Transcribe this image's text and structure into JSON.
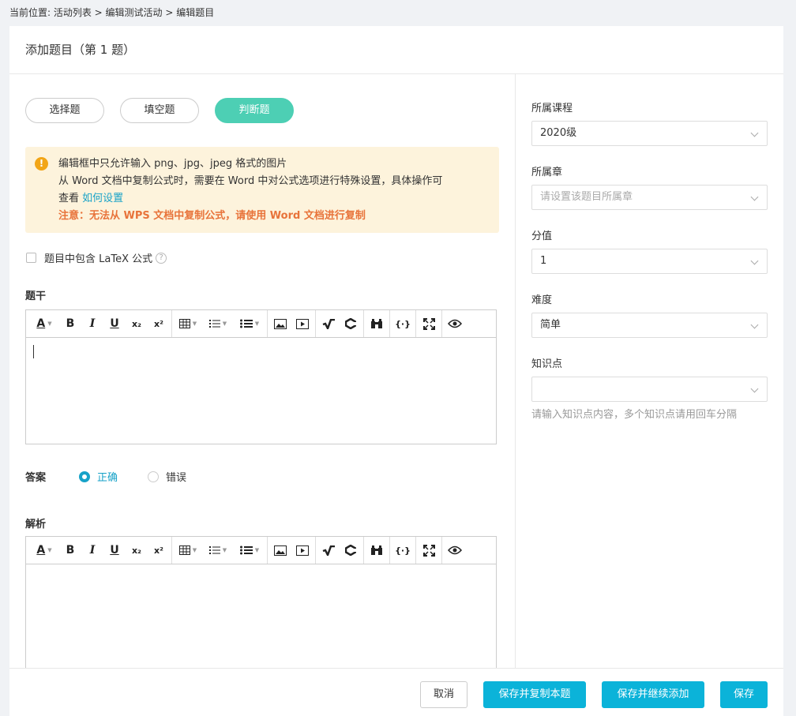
{
  "breadcrumb": {
    "text": "当前位置: 活动列表 > 编辑测试活动 > 编辑题目"
  },
  "header": {
    "title": "添加题目（第 1 题）"
  },
  "question_types": [
    {
      "label": "选择题",
      "active": false
    },
    {
      "label": "填空题",
      "active": false
    },
    {
      "label": "判断题",
      "active": true
    }
  ],
  "notice": {
    "line1": "编辑框中只允许输入 png、jpg、jpeg 格式的图片",
    "line2": "从 Word 文档中复制公式时，需要在 Word 中对公式选项进行特殊设置，具体操作可",
    "line3_prefix": "查看",
    "link": "如何设置",
    "warning": "注意：无法从 WPS 文档中复制公式，请使用 Word 文档进行复制"
  },
  "latex_option": {
    "label": "题目中包含 LaTeX 公式",
    "help": "?"
  },
  "stem": {
    "label": "题干"
  },
  "answer": {
    "label": "答案",
    "options": [
      {
        "label": "正确",
        "selected": true
      },
      {
        "label": "错误",
        "selected": false
      }
    ]
  },
  "analysis": {
    "label": "解析"
  },
  "toolbar_glyphs": {
    "font_color": "A",
    "bold": "B",
    "italic": "I",
    "underline": "U",
    "subscript": "x₂",
    "superscript": "x²",
    "formula": "{·}"
  },
  "sidebar": {
    "course": {
      "label": "所属课程",
      "value": "2020级"
    },
    "chapter": {
      "label": "所属章",
      "placeholder": "请设置该题目所属章"
    },
    "score": {
      "label": "分值",
      "value": "1"
    },
    "difficulty": {
      "label": "难度",
      "value": "简单"
    },
    "knowledge": {
      "label": "知识点",
      "value": "",
      "hint": "请输入知识点内容，多个知识点请用回车分隔"
    }
  },
  "footer": {
    "cancel": "取消",
    "save_copy": "保存并复制本题",
    "save_continue": "保存并继续添加",
    "save": "保存"
  },
  "colors": {
    "accent": "#0bb3d9",
    "active_tab": "#4dcfb4",
    "link": "#17a2c8",
    "warning": "#e8733a",
    "notice_bg": "#fdf3dc"
  }
}
